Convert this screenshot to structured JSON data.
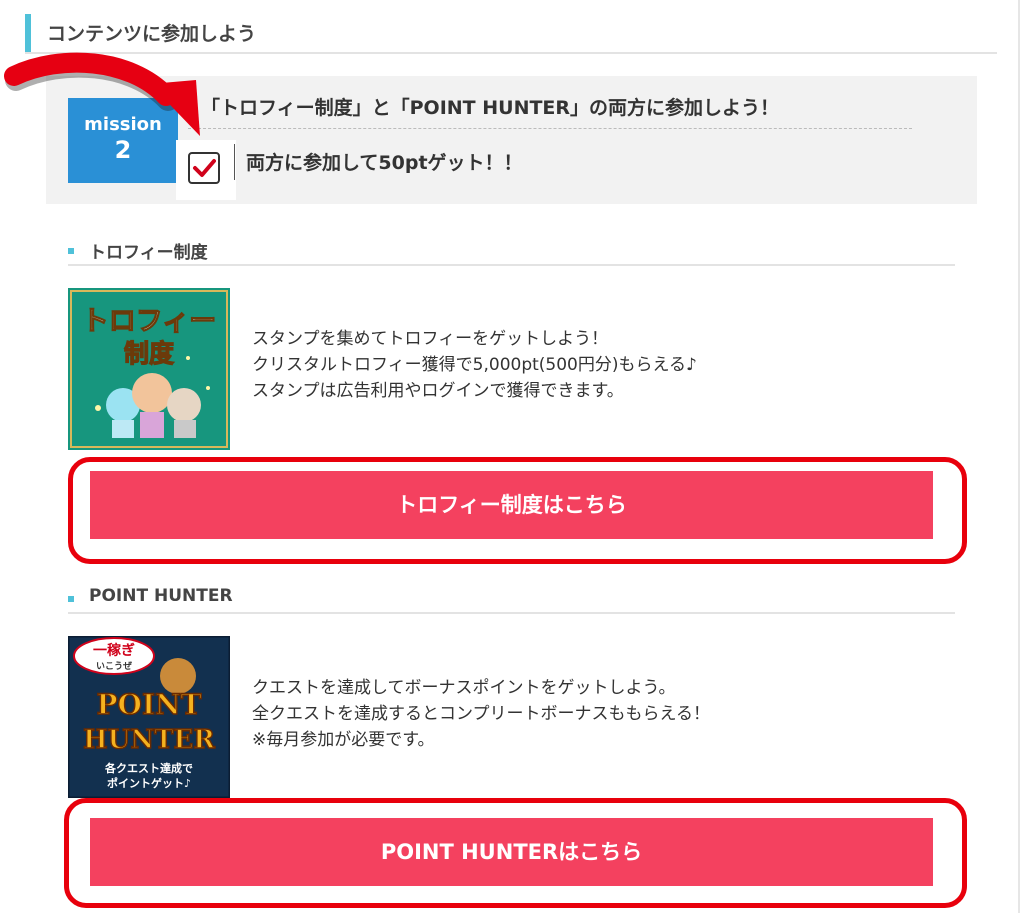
{
  "section": {
    "title": "コンテンツに参加しよう"
  },
  "mission": {
    "badge_label": "mission",
    "badge_number": "2",
    "title": "「トロフィー制度」と「POINT HUNTER」の両方に参加しよう！",
    "reward": "両方に参加して50ptゲット！！",
    "checked": true
  },
  "trophy": {
    "heading": "トロフィー制度",
    "image_text": [
      "トロフィー",
      "制度"
    ],
    "description": [
      "スタンプを集めてトロフィーをゲットしよう！",
      "クリスタルトロフィー獲得で5,000pt(500円分)もらえる♪",
      "スタンプは広告利用やログインで獲得できます。"
    ],
    "button_label": "トロフィー制度はこちら"
  },
  "hunter": {
    "heading": "POINT HUNTER",
    "image_text": {
      "bubble_1": "一稼ぎ",
      "bubble_2": "いこうぜ",
      "logo_1": "POINT",
      "logo_2": "HUNTER",
      "caption_1": "各クエスト達成で",
      "caption_2": "ポイントゲット♪"
    },
    "description": [
      "クエストを達成してボーナスポイントをゲットしよう。",
      "全クエストを達成するとコンプリートボーナスももらえる！",
      "※毎月参加が必要です。"
    ],
    "button_label": "POINT HUNTERはこちら"
  },
  "colors": {
    "accent": "#4fc1d9",
    "mission_badge": "#2a90d6",
    "button": "#f4415f",
    "highlight": "#e8000c",
    "arrow": "#e60012"
  },
  "icons": [
    "red-arrow-icon",
    "checkbox-checked-icon"
  ]
}
